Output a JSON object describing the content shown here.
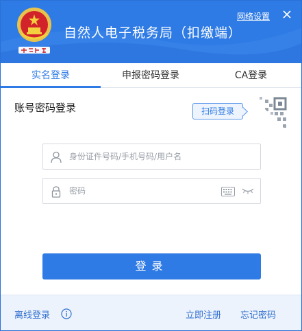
{
  "header": {
    "title": "自然人电子税务局（扣缴端）",
    "network_settings": "网络设置",
    "close_icon": "close-icon",
    "emblem_icon": "national-emblem-icon",
    "brand_color": "#2f7be5"
  },
  "tabs": [
    {
      "label": "实名登录",
      "active": true
    },
    {
      "label": "申报密码登录",
      "active": false
    },
    {
      "label": "CA登录",
      "active": false
    }
  ],
  "login": {
    "section_title": "账号密码登录",
    "scan_button": "扫码登录",
    "username_placeholder": "身份证件号码/手机号码/用户名",
    "username_value": "",
    "password_placeholder": "密码",
    "password_value": "",
    "submit_label": "登录"
  },
  "footer": {
    "offline_login": "离线登录",
    "register": "立即注册",
    "forgot_password": "忘记密码"
  }
}
